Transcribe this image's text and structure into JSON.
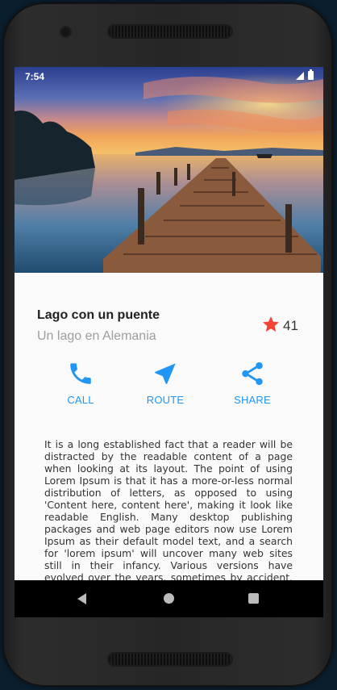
{
  "status_bar": {
    "time": "7:54"
  },
  "header": {
    "title": "Lago con un puente",
    "subtitle": "Un lago en Alemania"
  },
  "rating": {
    "count": "41",
    "icon": "star-icon",
    "color": "#f44336"
  },
  "actions": [
    {
      "label": "CALL",
      "icon": "phone-icon"
    },
    {
      "label": "ROUTE",
      "icon": "navigation-icon"
    },
    {
      "label": "SHARE",
      "icon": "share-icon"
    }
  ],
  "accent_color": "#2196f3",
  "description": "It is a long established fact that a reader will be distracted by the readable content of a page when looking at its layout. The point of using Lorem Ipsum is that it has a more-or-less normal distribution of letters, as opposed to using 'Content here, content here', making it look like readable English. Many desktop publishing packages and web page editors now use Lorem Ipsum as their default model text, and a search for 'lorem ipsum' will uncover many web sites still in their infancy. Various versions have evolved over the years, sometimes by accident, sometimes on purpose (injected humour and the like).",
  "nav": {
    "back_icon": "back-triangle-icon",
    "home_icon": "home-circle-icon",
    "recent_icon": "recents-square-icon"
  }
}
